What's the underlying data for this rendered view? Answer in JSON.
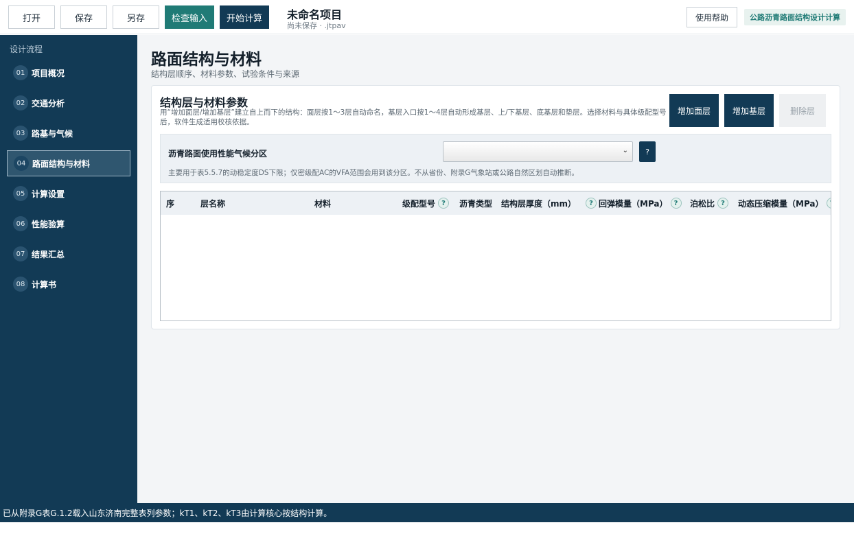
{
  "toolbar": {
    "open": "打开",
    "save": "保存",
    "save_as": "另存",
    "check_input": "检查输入",
    "start_calc": "开始计算"
  },
  "project": {
    "title": "未命名项目",
    "status": "尚未保存 · .jtpav"
  },
  "header_right": {
    "help": "使用帮助",
    "app_name": "公路沥青路面结构设计计算"
  },
  "sidebar": {
    "title": "设计流程",
    "items": [
      {
        "num": "01",
        "label": "项目概况"
      },
      {
        "num": "02",
        "label": "交通分析"
      },
      {
        "num": "03",
        "label": "路基与气候"
      },
      {
        "num": "04",
        "label": "路面结构与材料"
      },
      {
        "num": "05",
        "label": "计算设置"
      },
      {
        "num": "06",
        "label": "性能验算"
      },
      {
        "num": "07",
        "label": "结果汇总"
      },
      {
        "num": "08",
        "label": "计算书"
      }
    ],
    "active_index": 3
  },
  "page": {
    "title": "路面结构与材料",
    "subtitle": "结构层顺序、材料参数、试验条件与来源"
  },
  "card": {
    "title": "结构层与材料参数",
    "description": "用“增加面层/增加基层”建立自上而下的结构：面层按1～3层自动命名，基层入口按1～4层自动形成基层、上/下基层、底基层和垫层。选择材料与具体级配型号后，软件生成适用校核依据。",
    "buttons": {
      "add_surface": "增加面层",
      "add_base": "增加基层",
      "delete_layer": "删除层"
    }
  },
  "climate_zone": {
    "label": "沥青路面使用性能气候分区",
    "selected": "",
    "help": "?",
    "note": "主要用于表5.5.7的动稳定度DS下限；仅密级配AC的VFA范围会用到该分区。不从省份、附录G气象站或公路自然区划自动推断。"
  },
  "table": {
    "columns": [
      {
        "label": "序",
        "help": false
      },
      {
        "label": "层名称",
        "help": false
      },
      {
        "label": "材料",
        "help": false
      },
      {
        "label": "级配型号",
        "help": true
      },
      {
        "label": "沥青类型",
        "help": false
      },
      {
        "label": "结构层厚度（mm）",
        "help": true
      },
      {
        "label": "回弹模量（MPa）",
        "help": true
      },
      {
        "label": "泊松比",
        "help": true
      },
      {
        "label": "动态压缩模量（MPa）",
        "help": true
      }
    ],
    "help_glyph": "?",
    "rows": []
  },
  "status_bar": {
    "message": "已从附录G表G.1.2载入山东济南完整表列参数；kT1、kT2、kT3由计算核心按结构计算。"
  }
}
